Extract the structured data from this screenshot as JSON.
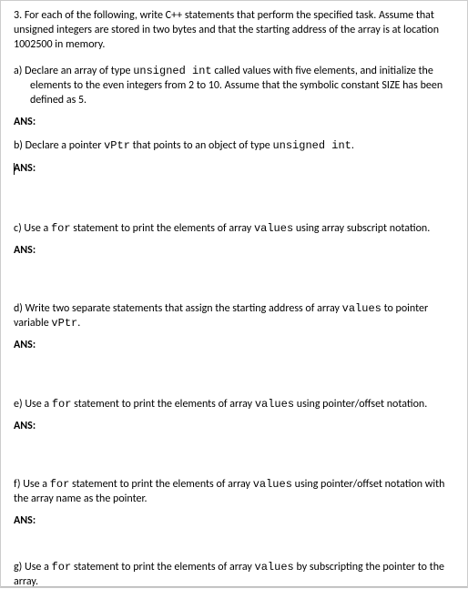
{
  "intro": "3. For each of the following, write C++ statements that perform the specified task. Assume that unsigned integers are stored in two bytes and that the starting address of the array is at location 1002500 in memory.",
  "parts": {
    "a": {
      "line1_pre": "a) Declare an array of type ",
      "line1_code": "unsigned int",
      "line1_post": " called values with five elements, and initialize the",
      "line2": "elements to the even integers from 2 to 10. Assume that the symbolic constant SIZE has been",
      "line3": "defined as 5."
    },
    "b": {
      "pre": "b) Declare a pointer ",
      "code1": "vPtr",
      "mid": " that points to an object of type ",
      "code2": "unsigned int",
      "post": "."
    },
    "c": {
      "pre": "c) Use a ",
      "code1": "for",
      "mid": " statement to print the elements of array ",
      "code2": "values",
      "post": " using array subscript notation."
    },
    "d": {
      "pre": "d) Write two separate statements that assign the starting address of array ",
      "code1": "values",
      "mid": " to pointer variable ",
      "code2": "vPtr",
      "post": "."
    },
    "e": {
      "pre": "e) Use a ",
      "code1": "for",
      "mid": " statement to print the elements of array ",
      "code2": "values",
      "post": " using pointer/offset notation."
    },
    "f": {
      "pre": "f) Use a ",
      "code1": "for",
      "mid": " statement to print the elements of array ",
      "code2": "values",
      "post": " using pointer/offset notation with the array name as the pointer."
    },
    "g": {
      "pre": "g) Use a ",
      "code1": "for",
      "mid": " statement to print the elements of array ",
      "code2": "values",
      "post": " by subscripting the pointer to the array."
    }
  },
  "ans_label": "ANS:"
}
